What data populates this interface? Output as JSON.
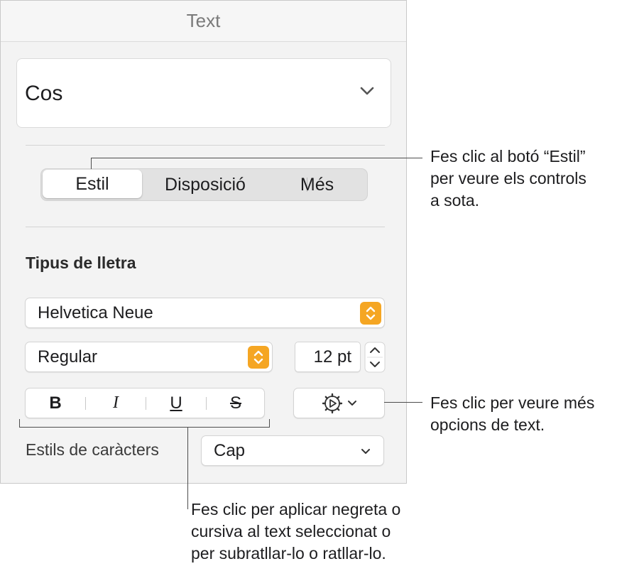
{
  "panel": {
    "title": "Text",
    "paragraph_style": "Cos",
    "tabs": [
      {
        "label": "Estil",
        "selected": true
      },
      {
        "label": "Disposició",
        "selected": false
      },
      {
        "label": "Més",
        "selected": false
      }
    ],
    "font_section_title": "Tipus de lletra",
    "font_family": "Helvetica Neue",
    "font_typeface": "Regular",
    "font_size": "12 pt",
    "format_buttons": [
      "B",
      "I",
      "U",
      "S"
    ],
    "char_styles_label": "Estils de caràcters",
    "char_style_value": "Cap"
  },
  "callouts": {
    "style_button": [
      "Fes clic al botó “Estil”",
      "per veure els controls",
      "a sota."
    ],
    "more_options": [
      "Fes clic per veure més",
      "opcions de text."
    ],
    "format": [
      "Fes clic per aplicar negreta o",
      "cursiva al text seleccionat o",
      "per subratllar-lo o ratllar-lo."
    ]
  },
  "colors": {
    "accent_orange": "#f5a623",
    "panel_bg": "#f3f3f3"
  },
  "icons": [
    "chevron-down-icon",
    "stepper-icon",
    "gear-icon"
  ]
}
